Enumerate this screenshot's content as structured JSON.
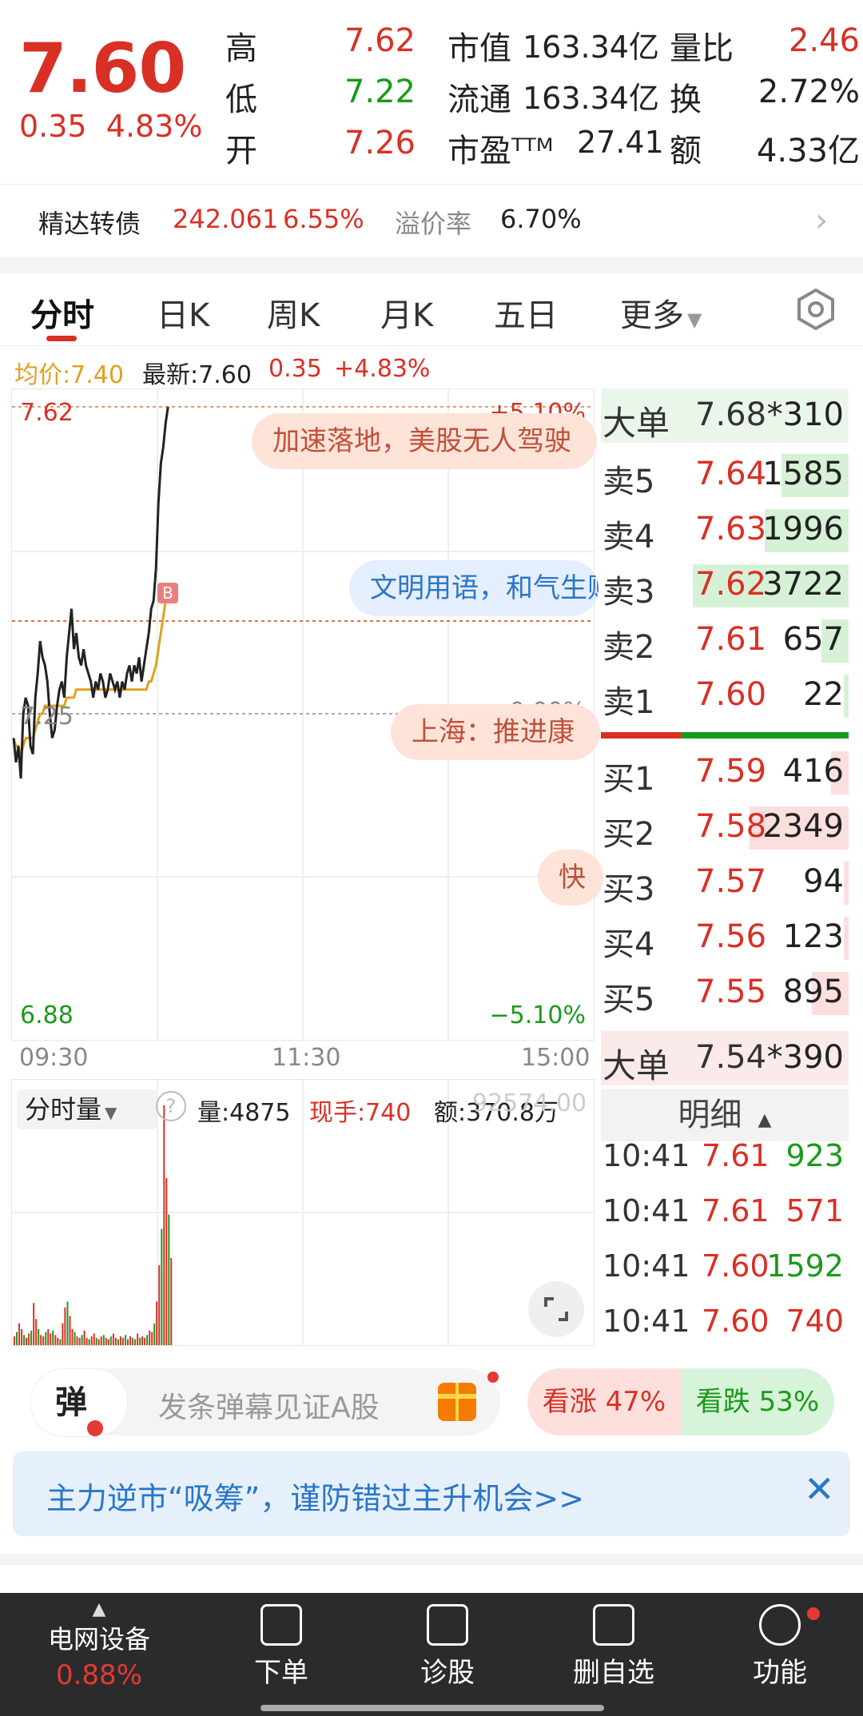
{
  "quote": {
    "price": "7.60",
    "change": "0.35",
    "change_pct": "4.83%",
    "rows": [
      {
        "l1": "高",
        "v1": "7.62",
        "l2": "市值",
        "v2": "163.34亿",
        "l3": "量比",
        "v3": "2.46"
      },
      {
        "l1": "低",
        "v1": "7.22",
        "l2": "流通",
        "v2": "163.34亿",
        "l3": "换",
        "v3": "2.72%"
      },
      {
        "l1": "开",
        "v1": "7.26",
        "l2": "市盈ᵀᵀᴹ",
        "v2": "27.41",
        "l3": "额",
        "v3": "4.33亿"
      }
    ]
  },
  "convertible": {
    "name": "精达转债",
    "price": "242.061",
    "pct": "6.55%",
    "premium_label": "溢价率",
    "premium": "6.70%"
  },
  "tabs": [
    "分时",
    "日K",
    "周K",
    "月K",
    "五日",
    "更多"
  ],
  "chart": {
    "avg_label": "均价:7.40",
    "latest_label": "最新:7.60",
    "change": "0.35",
    "change_pct": "+4.83%",
    "y_high": "7.62",
    "y_mid": "7.25",
    "y_low": "6.88",
    "pct_high": "+5.10%",
    "pct_mid": "0.00%",
    "pct_low": "−5.10%",
    "t_start": "09:30",
    "t_mid": "11:30",
    "t_end": "15:00",
    "buy_marker": "B",
    "price_series": [
      7.21,
      7.18,
      7.2,
      7.16,
      7.24,
      7.26,
      7.25,
      7.2,
      7.19,
      7.26,
      7.29,
      7.33,
      7.31,
      7.3,
      7.28,
      7.24,
      7.21,
      7.22,
      7.25,
      7.27,
      7.28,
      7.26,
      7.31,
      7.34,
      7.37,
      7.32,
      7.34,
      7.31,
      7.3,
      7.32,
      7.3,
      7.29,
      7.28,
      7.26,
      7.28,
      7.27,
      7.29,
      7.28,
      7.26,
      7.27,
      7.29,
      7.28,
      7.27,
      7.28,
      7.26,
      7.28,
      7.27,
      7.29,
      7.3,
      7.28,
      7.3,
      7.29,
      7.31,
      7.28,
      7.3,
      7.32,
      7.34,
      7.37,
      7.38,
      7.42,
      7.5,
      7.55,
      7.57,
      7.6,
      7.62
    ],
    "avg_series": [
      7.21,
      7.2,
      7.2,
      7.19,
      7.2,
      7.21,
      7.21,
      7.21,
      7.21,
      7.22,
      7.23,
      7.24,
      7.24,
      7.25,
      7.25,
      7.25,
      7.25,
      7.25,
      7.25,
      7.25,
      7.25,
      7.25,
      7.26,
      7.26,
      7.26,
      7.26,
      7.27,
      7.27,
      7.27,
      7.27,
      7.27,
      7.27,
      7.27,
      7.27,
      7.27,
      7.27,
      7.27,
      7.27,
      7.27,
      7.27,
      7.27,
      7.27,
      7.27,
      7.27,
      7.27,
      7.27,
      7.27,
      7.27,
      7.27,
      7.27,
      7.27,
      7.27,
      7.27,
      7.27,
      7.27,
      7.27,
      7.28,
      7.28,
      7.29,
      7.3,
      7.32,
      7.34,
      7.36,
      7.38,
      7.4
    ]
  },
  "bullets": [
    "加速落地，美股无人驾驶",
    "文明用语，和气生财",
    "上海：推进康",
    "快"
  ],
  "volume": {
    "selector": "分时量",
    "help": "?",
    "vol_label": "量:4875",
    "now_label": "现手:740",
    "amt_label": "额:370.8万",
    "overlay": "92574.00",
    "bars": [
      12,
      18,
      30,
      22,
      14,
      10,
      16,
      20,
      58,
      36,
      22,
      14,
      12,
      18,
      22,
      16,
      20,
      14,
      10,
      8,
      30,
      52,
      60,
      40,
      22,
      18,
      12,
      10,
      14,
      20,
      10,
      8,
      12,
      16,
      10,
      8,
      12,
      14,
      10,
      8,
      12,
      16,
      10,
      8,
      12,
      10,
      14,
      8,
      12,
      10,
      8,
      16,
      10,
      12,
      10,
      14,
      20,
      18,
      30,
      60,
      110,
      160,
      330,
      230,
      180,
      120
    ]
  },
  "orderbook": {
    "big_top": {
      "label": "大单",
      "price": "7.68",
      "vol": "*310"
    },
    "sells": [
      {
        "label": "卖5",
        "price": "7.64",
        "vol": "1585",
        "ratio": 0.27
      },
      {
        "label": "卖4",
        "price": "7.63",
        "vol": "1996",
        "ratio": 0.34
      },
      {
        "label": "卖3",
        "price": "7.62",
        "vol": "3722",
        "ratio": 0.63
      },
      {
        "label": "卖2",
        "price": "7.61",
        "vol": "657",
        "ratio": 0.11
      },
      {
        "label": "卖1",
        "price": "7.60",
        "vol": "22",
        "ratio": 0.02
      }
    ],
    "buys": [
      {
        "label": "买1",
        "price": "7.59",
        "vol": "416",
        "ratio": 0.07
      },
      {
        "label": "买2",
        "price": "7.58",
        "vol": "2349",
        "ratio": 0.4
      },
      {
        "label": "买3",
        "price": "7.57",
        "vol": "94",
        "ratio": 0.02
      },
      {
        "label": "买4",
        "price": "7.56",
        "vol": "123",
        "ratio": 0.02
      },
      {
        "label": "买5",
        "price": "7.55",
        "vol": "895",
        "ratio": 0.15
      }
    ],
    "big_bottom": {
      "label": "大单",
      "price": "7.54",
      "vol": "*390"
    },
    "detail_label": "明细",
    "ticks": [
      {
        "time": "10:41",
        "price": "7.61",
        "vol": "923"
      },
      {
        "time": "10:41",
        "price": "7.61",
        "vol": "571"
      },
      {
        "time": "10:41",
        "price": "7.60",
        "vol": "1592"
      },
      {
        "time": "10:41",
        "price": "7.60",
        "vol": "740"
      }
    ]
  },
  "danmu": {
    "icon": "弹",
    "placeholder": "发条弹幕见证A股",
    "up": "看涨 47%",
    "down": "看跌 53%"
  },
  "banner": {
    "text": "主力逆市“吸筹”，谨防错过主升机会>>"
  },
  "nav": {
    "sector_name": "电网设备",
    "sector_pct": "0.88%",
    "items": [
      "下单",
      "诊股",
      "删自选",
      "功能"
    ]
  },
  "colors": {
    "up": "#d93025",
    "down": "#1a9a1a",
    "avg": "#e0a020",
    "nav_bg": "#2b2b2b",
    "banner_bg": "#e6f0fb",
    "banner_text": "#2a76c9"
  }
}
